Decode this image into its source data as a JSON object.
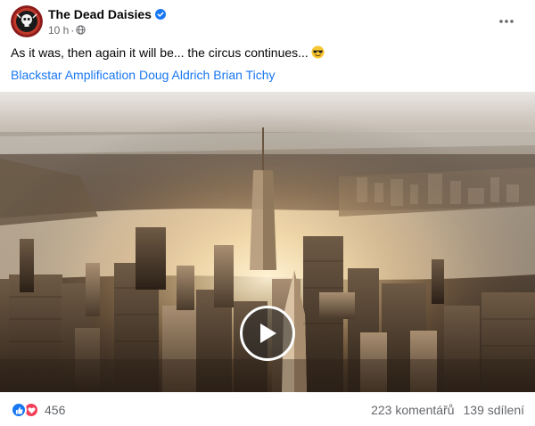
{
  "post": {
    "page_name": "The Dead Daisies",
    "verified": true,
    "timestamp": "10 h",
    "audience_icon": "globe-icon",
    "caption": "As it was, then again it will be... the circus continues...",
    "caption_emoji": "sunglasses-emoji",
    "tags": [
      {
        "label": "Blackstar Amplification"
      },
      {
        "label": "Doug Aldrich"
      },
      {
        "label": "Brian Tichy"
      }
    ]
  },
  "media": {
    "type": "video",
    "play_icon": "play-icon"
  },
  "footer": {
    "reaction_icons": [
      "like-icon",
      "love-icon"
    ],
    "reaction_count": "456",
    "comments": "223 komentářů",
    "shares": "139 sdílení"
  },
  "colors": {
    "link": "#1877f2",
    "secondary_text": "#65676b",
    "like": "#1877f2",
    "love": "#f33e58",
    "verified": "#1877f2"
  }
}
